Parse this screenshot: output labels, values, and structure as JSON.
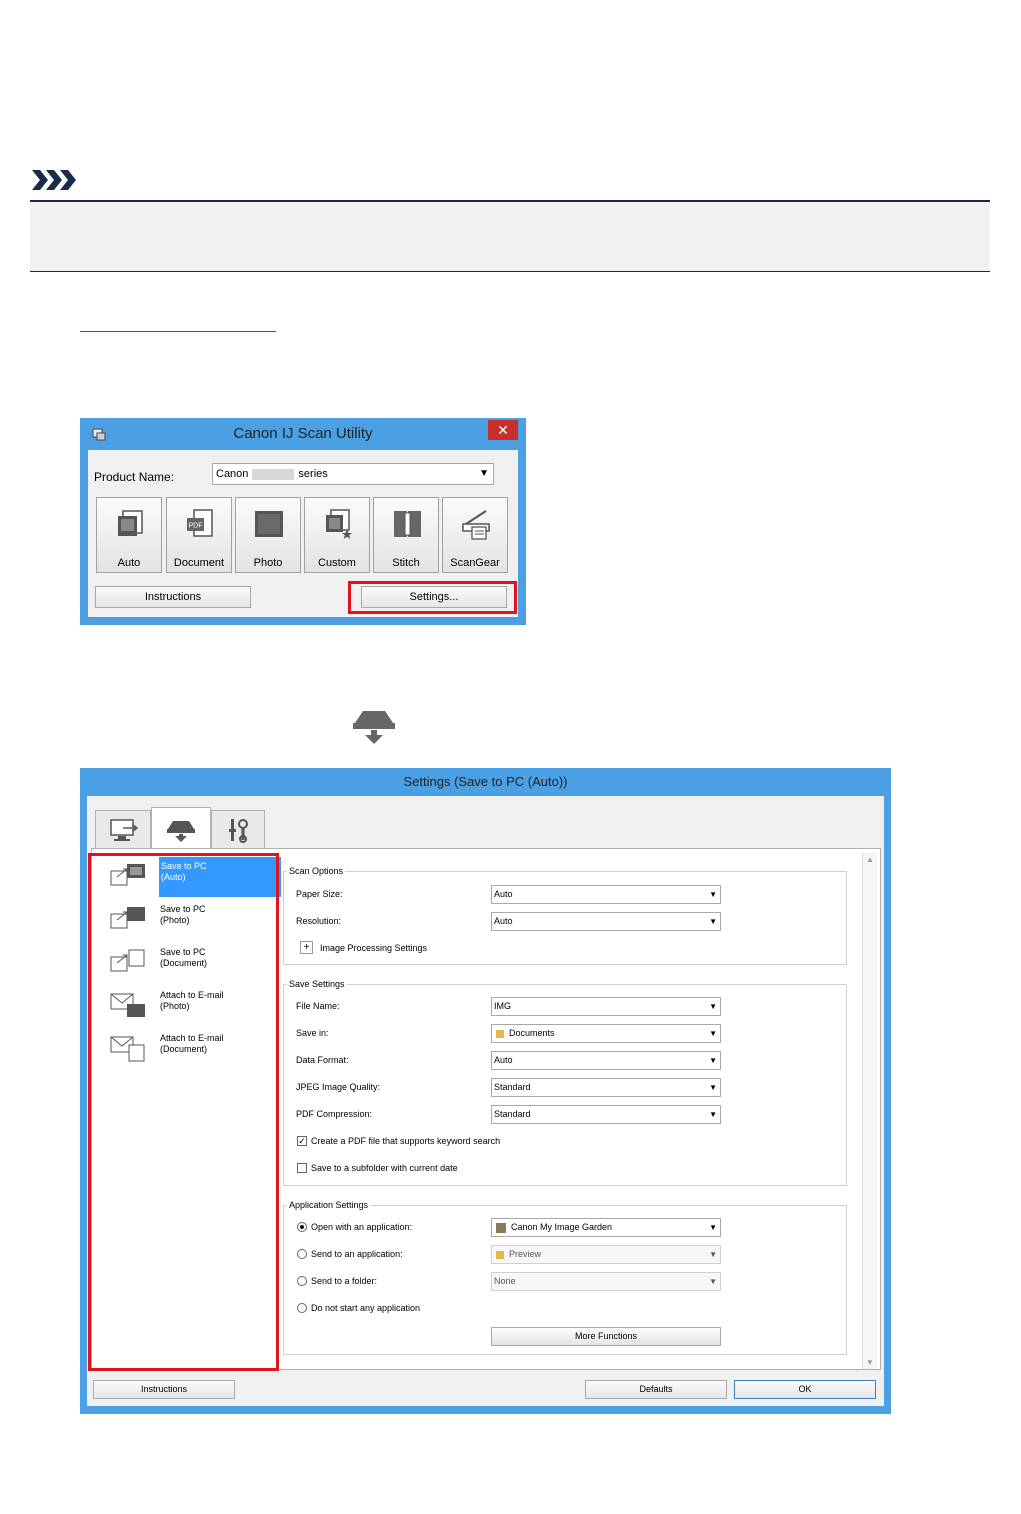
{
  "utility_window": {
    "title": "Canon IJ Scan Utility",
    "close_glyph": "✕",
    "product_label": "Product Name:",
    "product_value_prefix": "Canon",
    "product_value_suffix": "series",
    "buttons": [
      "Auto",
      "Document",
      "Photo",
      "Custom",
      "Stitch",
      "ScanGear"
    ],
    "instructions_label": "Instructions",
    "settings_label": "Settings..."
  },
  "settings_window": {
    "title": "Settings (Save to PC (Auto))",
    "list_items": [
      {
        "line1": "Save to PC",
        "line2": "(Auto)"
      },
      {
        "line1": "Save to PC",
        "line2": "(Photo)"
      },
      {
        "line1": "Save to PC",
        "line2": "(Document)"
      },
      {
        "line1": "Attach to E-mail",
        "line2": "(Photo)"
      },
      {
        "line1": "Attach to E-mail",
        "line2": "(Document)"
      }
    ],
    "scan_options": {
      "group_label": "Scan Options",
      "paper_size_label": "Paper Size:",
      "paper_size_value": "Auto",
      "resolution_label": "Resolution:",
      "resolution_value": "Auto",
      "image_processing_label": "Image Processing Settings"
    },
    "save_settings": {
      "group_label": "Save Settings",
      "file_name_label": "File Name:",
      "file_name_value": "IMG",
      "save_in_label": "Save in:",
      "save_in_value": "Documents",
      "data_format_label": "Data Format:",
      "data_format_value": "Auto",
      "jpeg_label": "JPEG Image Quality:",
      "jpeg_value": "Standard",
      "pdf_label": "PDF Compression:",
      "pdf_value": "Standard",
      "keyword_search_label": "Create a PDF file that supports keyword search",
      "keyword_search_checked": true,
      "subfolder_label": "Save to a subfolder with current date",
      "subfolder_checked": false
    },
    "application_settings": {
      "group_label": "Application Settings",
      "open_with_label": "Open with an application:",
      "open_with_value": "Canon My Image Garden",
      "send_to_app_label": "Send to an application:",
      "send_to_app_value": "Preview",
      "send_to_folder_label": "Send to a folder:",
      "send_to_folder_value": "None",
      "do_not_start_label": "Do not start any application",
      "selected_option": "Open with an application:",
      "more_functions_label": "More Functions"
    },
    "instructions_label": "Instructions",
    "defaults_label": "Defaults",
    "ok_label": "OK"
  },
  "colors": {
    "highlight_red": "#e0141e",
    "window_frame_blue": "#4aa0e2",
    "selection_blue": "#3399ff"
  }
}
